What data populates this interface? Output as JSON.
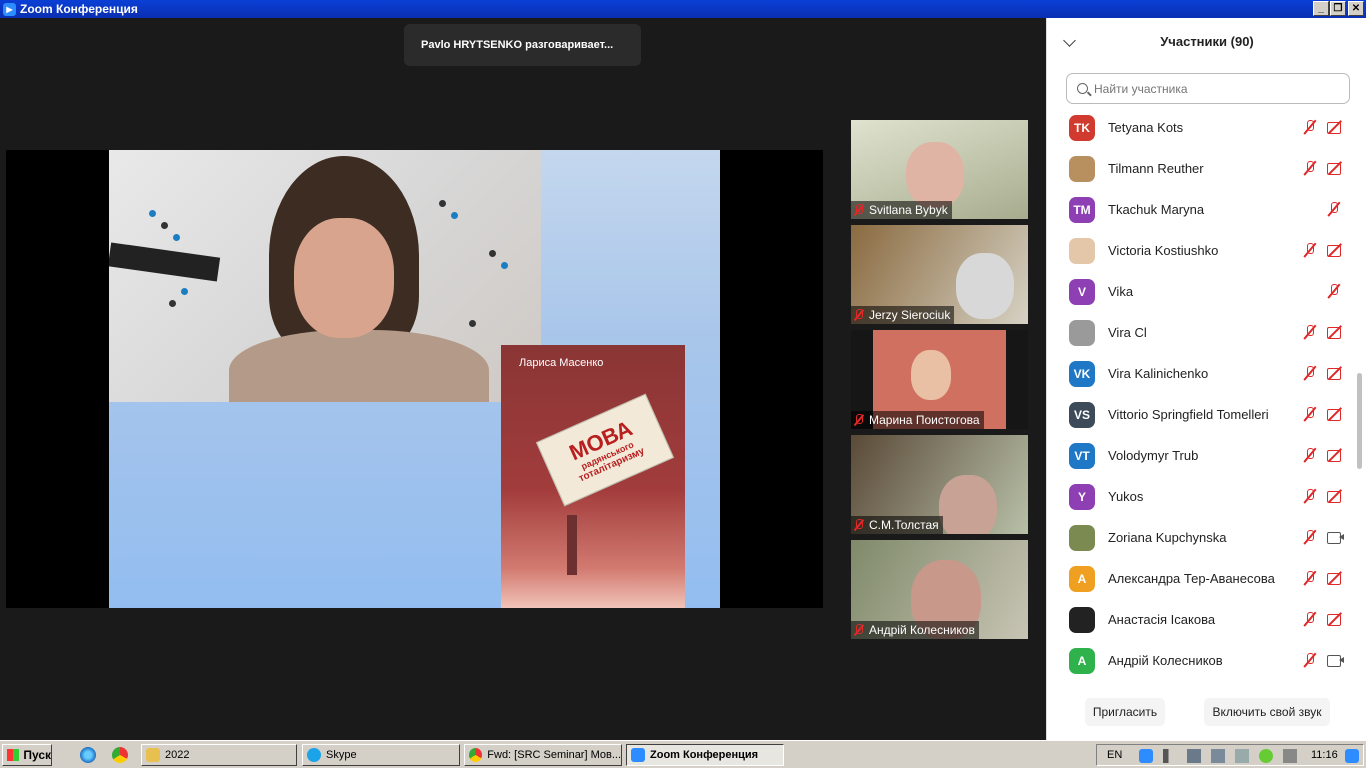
{
  "window": {
    "title": "Zoom Конференция"
  },
  "talking_indicator": "Pavlo HRYTSENKO разговаривает...",
  "slide": {
    "book_author": "Лариса Масенко",
    "book_title_line1": "МОВА",
    "book_title_line2": "радянського",
    "book_title_line3": "тоталітаризму"
  },
  "video_tiles": [
    {
      "name": "Svitlana Bybyk"
    },
    {
      "name": "Jerzy Sierociuk"
    },
    {
      "name": "Марина Поистогова"
    },
    {
      "name": "С.М.Толстая"
    },
    {
      "name": "Андрій Колесников"
    }
  ],
  "participants_panel": {
    "title": "Участники (90)",
    "search_placeholder": "Найти участника",
    "invite_label": "Пригласить",
    "unmute_label": "Включить свой звук",
    "participants": [
      {
        "initials": "TK",
        "name": "Tetyana Kots",
        "avatar_color": "#d13b2f",
        "mic": "off",
        "video": "off"
      },
      {
        "initials": "",
        "name": "Tilmann Reuther",
        "avatar_color": "#b89060",
        "mic": "off",
        "video": "off"
      },
      {
        "initials": "TM",
        "name": "Tkachuk Maryna",
        "avatar_color": "#8d3fb3",
        "mic": "off",
        "video": "none"
      },
      {
        "initials": "",
        "name": "Victoria Kostiushko",
        "avatar_color": "#e4c6a8",
        "mic": "off",
        "video": "off"
      },
      {
        "initials": "V",
        "name": "Vika",
        "avatar_color": "#8d3fb3",
        "mic": "off",
        "video": "none"
      },
      {
        "initials": "",
        "name": "Vira Cl",
        "avatar_color": "#9a9a9a",
        "mic": "off",
        "video": "off"
      },
      {
        "initials": "VK",
        "name": "Vira Kalinichenko",
        "avatar_color": "#1f78c6",
        "mic": "off",
        "video": "off"
      },
      {
        "initials": "VS",
        "name": "Vittorio Springfield Tomelleri",
        "avatar_color": "#3c4a5a",
        "mic": "off",
        "video": "off"
      },
      {
        "initials": "VT",
        "name": "Volodymyr Trub",
        "avatar_color": "#1f78c6",
        "mic": "off",
        "video": "off"
      },
      {
        "initials": "Y",
        "name": "Yukos",
        "avatar_color": "#8d3fb3",
        "mic": "off",
        "video": "off"
      },
      {
        "initials": "",
        "name": "Zoriana Kupchynska",
        "avatar_color": "#7a8a50",
        "mic": "off",
        "video": "on"
      },
      {
        "initials": "A",
        "name": "Александра Тер-Аванесова",
        "avatar_color": "#f0a020",
        "mic": "off",
        "video": "off"
      },
      {
        "initials": "",
        "name": "Анастасія Ісакова",
        "avatar_color": "#222222",
        "mic": "off",
        "video": "off"
      },
      {
        "initials": "A",
        "name": "Андрій Колесников",
        "avatar_color": "#2fb24c",
        "mic": "off",
        "video": "on"
      }
    ]
  },
  "taskbar": {
    "start_label": "Пуск",
    "buttons": [
      {
        "label": "2022"
      },
      {
        "label": "Skype"
      },
      {
        "label": "Fwd: [SRC Seminar] Мов..."
      },
      {
        "label": "Zoom Конференция"
      }
    ],
    "language": "EN",
    "clock": "11:16"
  }
}
